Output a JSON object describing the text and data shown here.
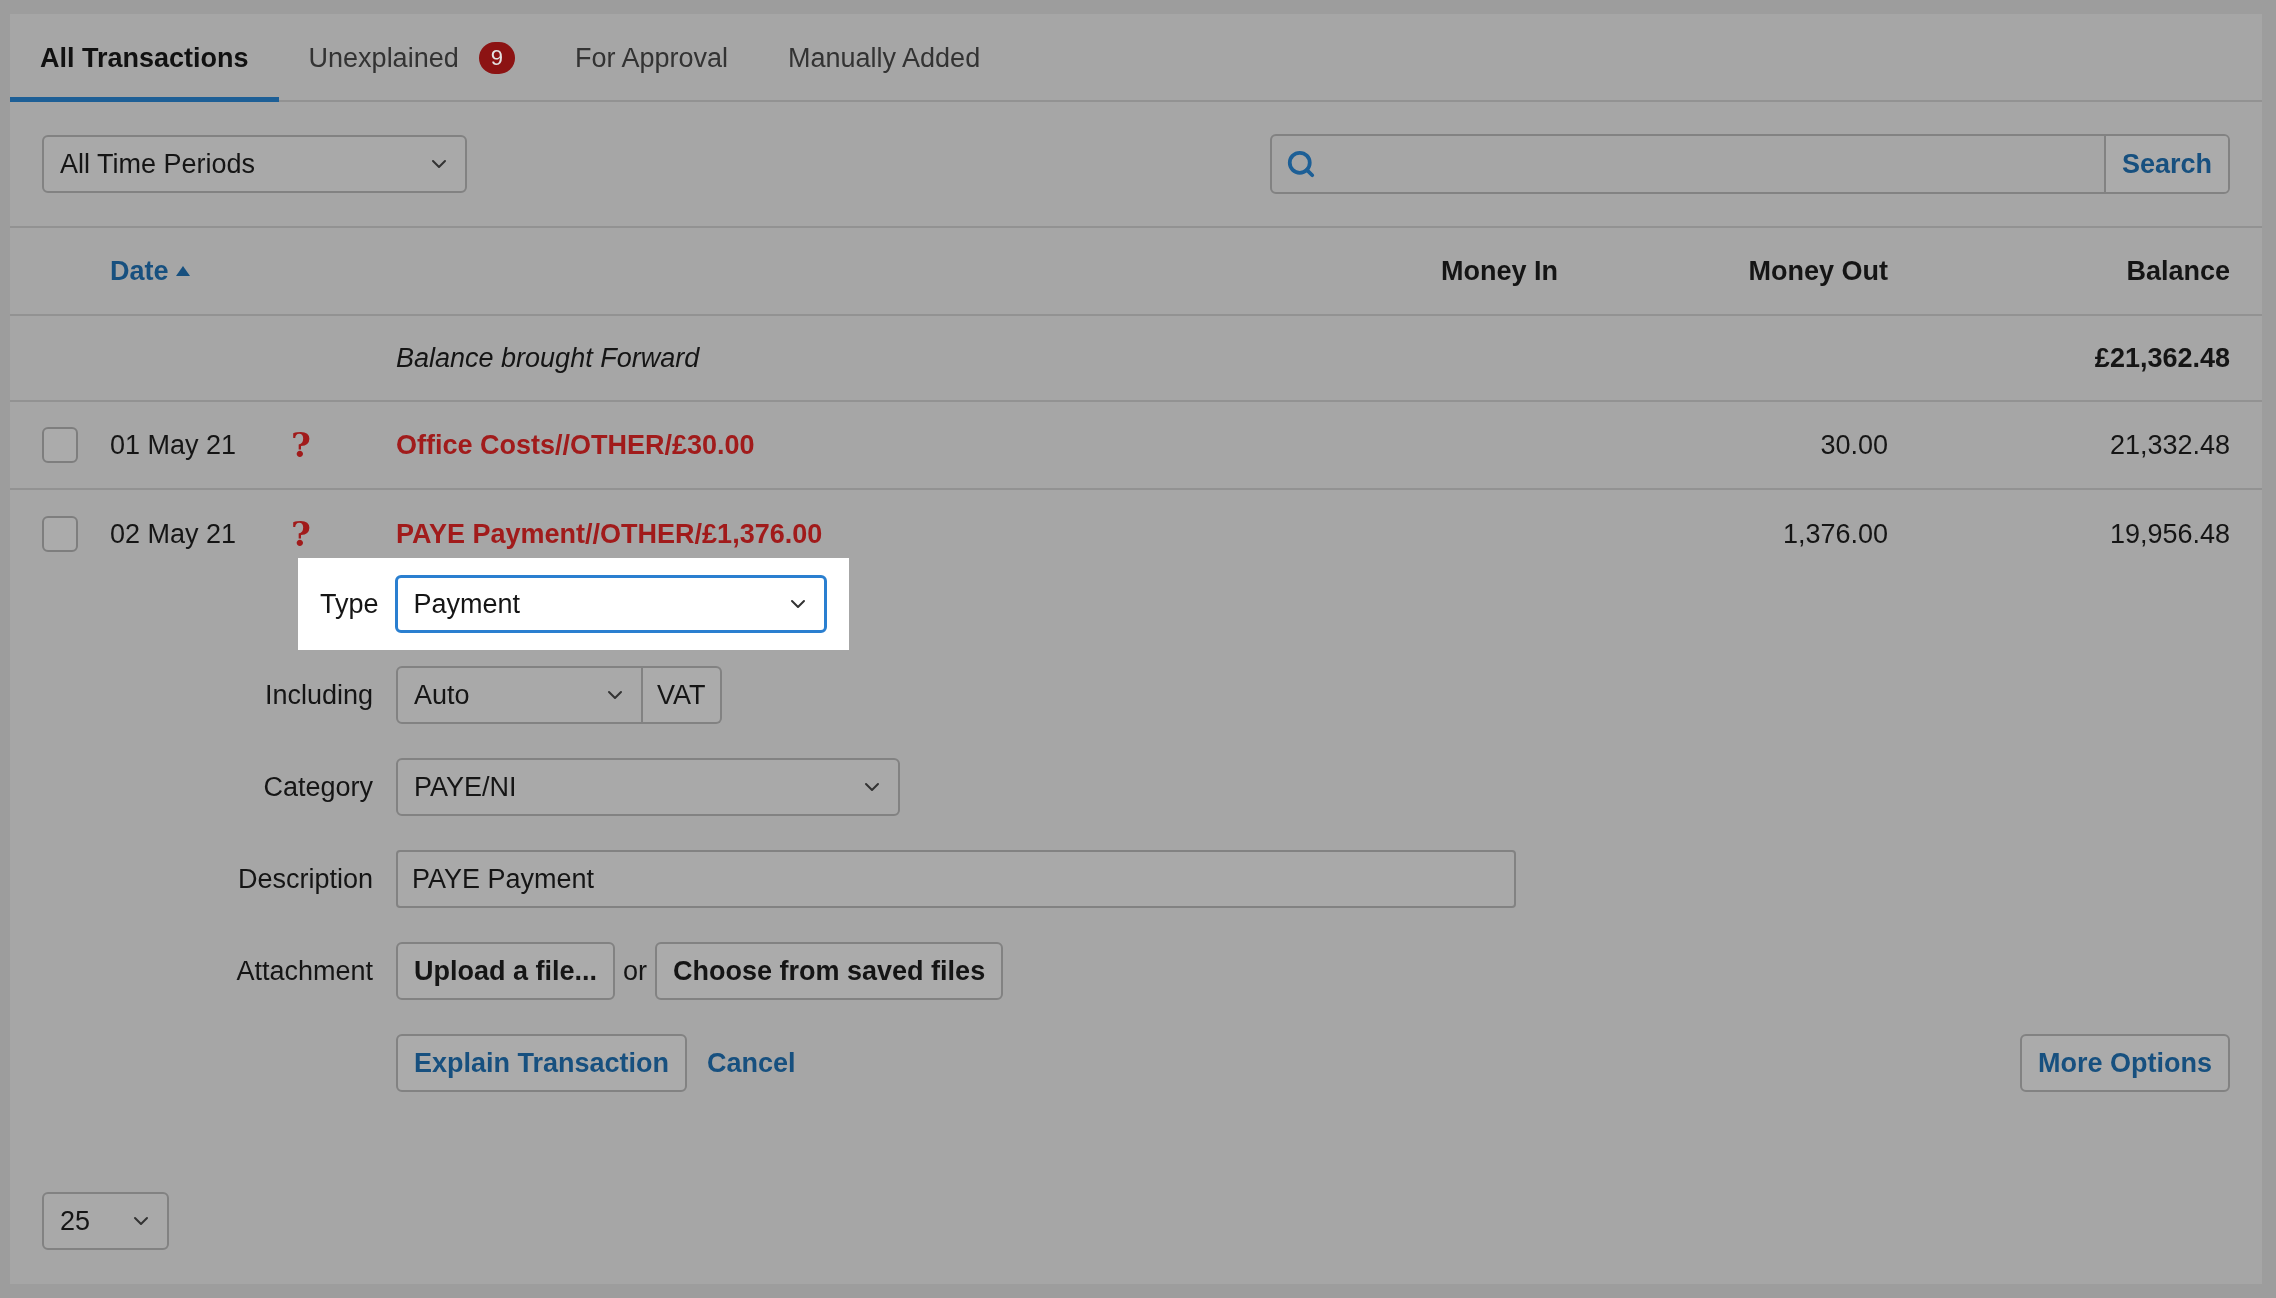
{
  "tabs": [
    {
      "label": "All Transactions",
      "selected": true
    },
    {
      "label": "Unexplained",
      "selected": false,
      "badge": "9"
    },
    {
      "label": "For Approval",
      "selected": false
    },
    {
      "label": "Manually Added",
      "selected": false
    }
  ],
  "period_select": {
    "value": "All Time Periods"
  },
  "search": {
    "button": "Search"
  },
  "table": {
    "columns": [
      {
        "label": "Date",
        "sort_ascending": true
      },
      {
        "label": "Money In"
      },
      {
        "label": "Money Out"
      },
      {
        "label": "Balance"
      }
    ],
    "rows": [
      {
        "kind": "balance",
        "description": "Balance brought Forward",
        "balance": "£21,362.48"
      },
      {
        "kind": "transaction",
        "checked": false,
        "date": "01 May 21",
        "status_icon": "?",
        "description": "Office Costs//OTHER/£30.00",
        "money_out": "30.00",
        "balance": "21,332.48"
      },
      {
        "kind": "transaction",
        "checked": false,
        "date": "02 May 21",
        "status_icon": "?",
        "description": "PAYE Payment//OTHER/£1,376.00",
        "money_out": "1,376.00",
        "balance": "19,956.48"
      }
    ]
  },
  "form": {
    "type": {
      "label": "Type",
      "value": "Payment",
      "highlighted": true
    },
    "including": {
      "label": "Including",
      "value": "Auto",
      "suffix": "VAT"
    },
    "category": {
      "label": "Category",
      "value": "PAYE/NI"
    },
    "description": {
      "label": "Description",
      "value": "PAYE Payment"
    },
    "attachment": {
      "label": "Attachment",
      "upload": "Upload a file...",
      "or": "or",
      "choose": "Choose from saved files"
    },
    "actions": {
      "explain": "Explain Transaction",
      "cancel": "Cancel",
      "more": "More Options"
    }
  },
  "per_page": {
    "value": "25"
  }
}
